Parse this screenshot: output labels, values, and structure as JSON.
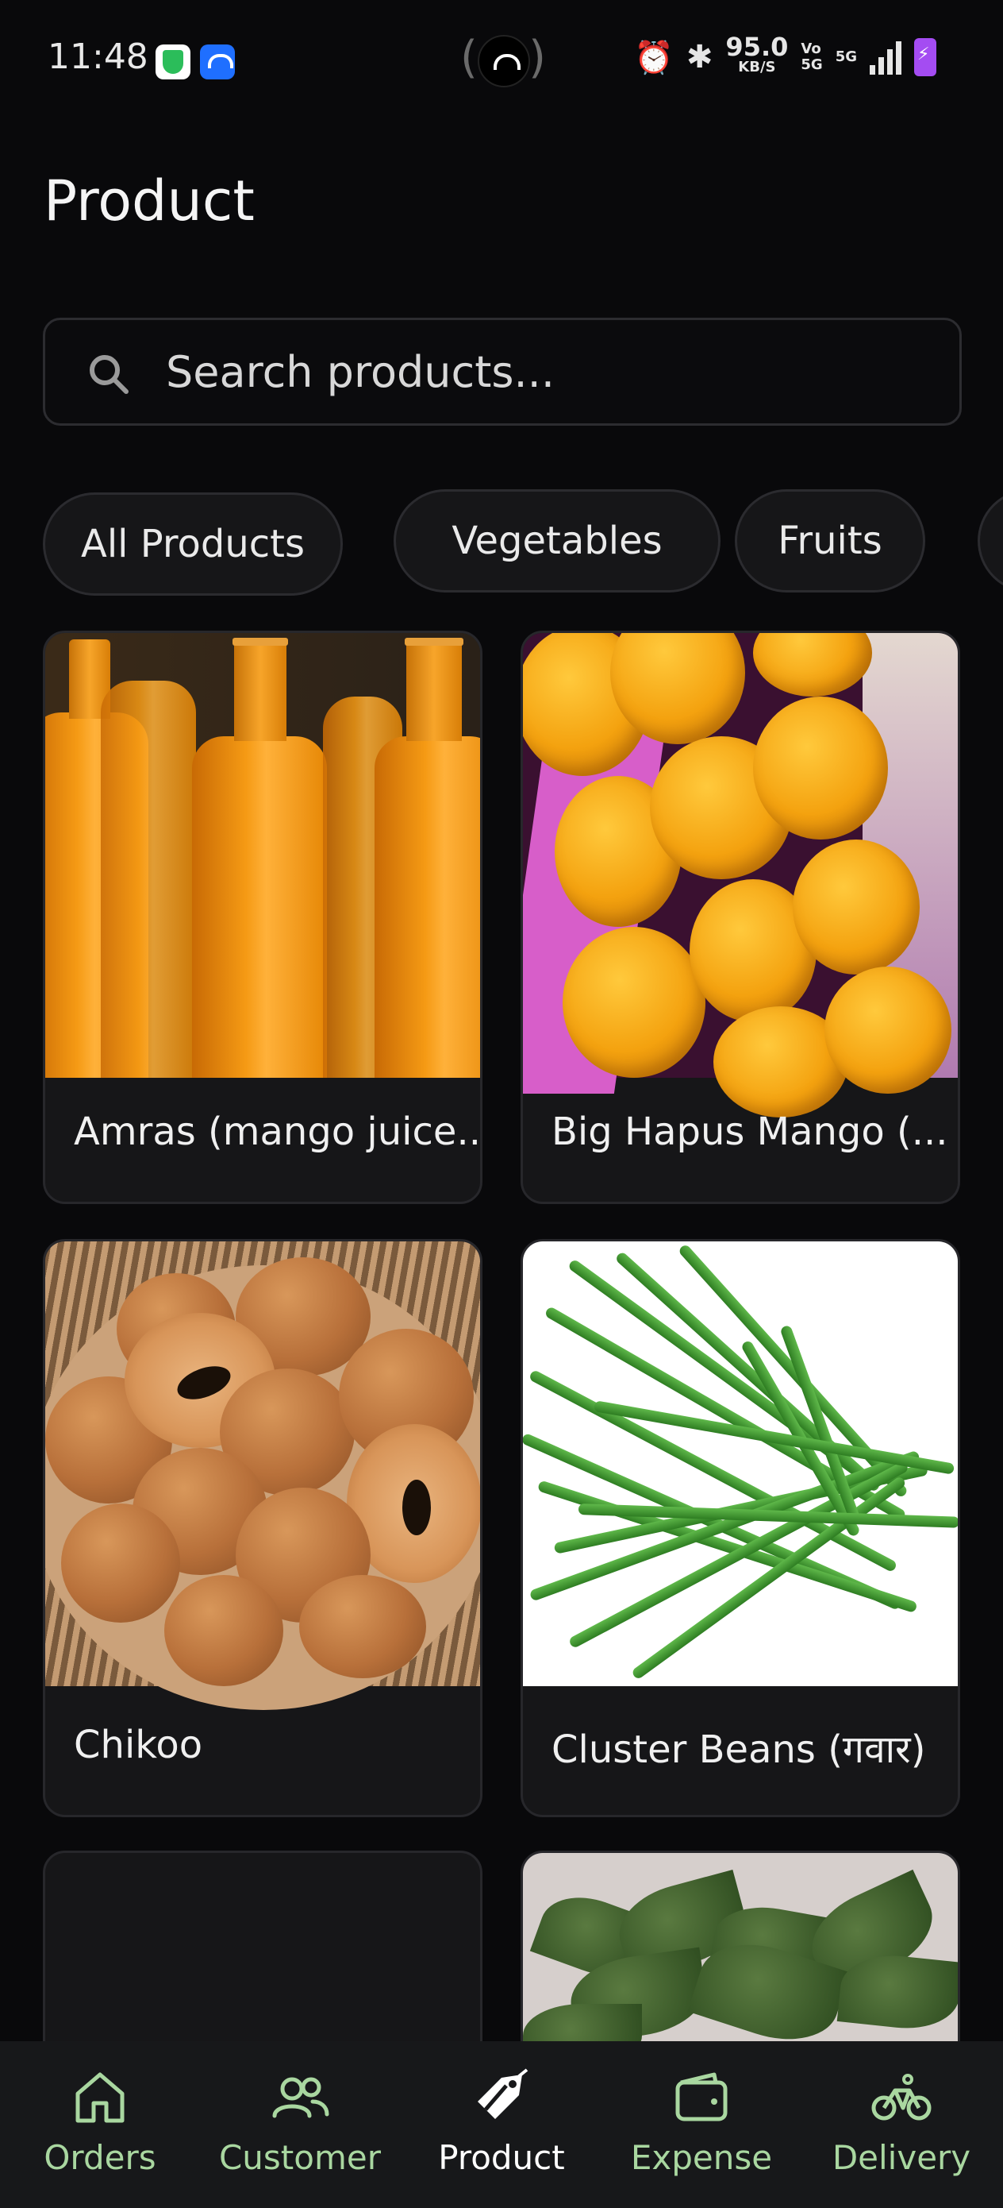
{
  "status_bar": {
    "time": "11:48",
    "net_speed": "95.0",
    "net_speed_unit": "KB/S",
    "volte_top": "Vo",
    "volte_bottom": "5G",
    "network": "5G",
    "battery_color": "#a44cf2"
  },
  "header": {
    "title": "Product"
  },
  "search": {
    "placeholder": "Search products..."
  },
  "filters": {
    "chips": [
      "All Products",
      "Vegetables",
      "Fruits"
    ],
    "selected": "All Products"
  },
  "products": [
    {
      "name": "Amras (mango juice...",
      "image": "mango-juice-bottles"
    },
    {
      "name": "Big Hapus Mango (...",
      "image": "mangoes-in-box"
    },
    {
      "name": "Chikoo",
      "image": "chikoo-basket"
    },
    {
      "name": "Cluster Beans (गवार)",
      "image": "cluster-beans"
    },
    {
      "name": "",
      "image": ""
    },
    {
      "name": "",
      "image": "leafy-greens"
    }
  ],
  "bottom_nav": {
    "items": [
      {
        "label": "Orders",
        "icon": "home-icon"
      },
      {
        "label": "Customer",
        "icon": "users-icon"
      },
      {
        "label": "Product",
        "icon": "tag-icon"
      },
      {
        "label": "Expense",
        "icon": "wallet-icon"
      },
      {
        "label": "Delivery",
        "icon": "bicycle-icon"
      }
    ],
    "active": "Product",
    "accent_color": "#a9d7a0"
  }
}
